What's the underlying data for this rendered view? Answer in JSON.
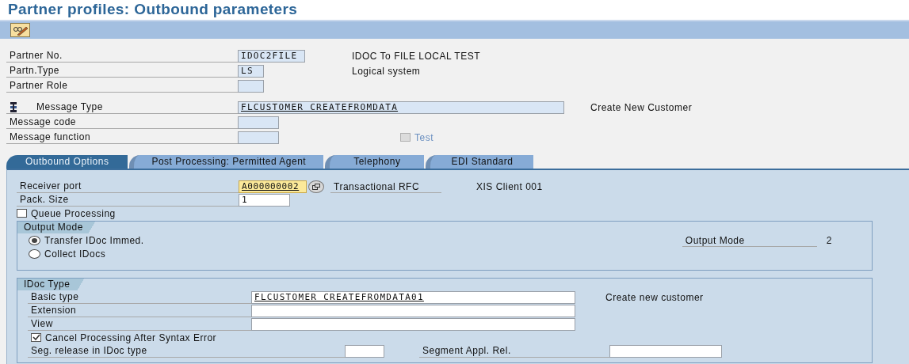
{
  "title": "Partner profiles: Outbound parameters",
  "header": [
    {
      "kind": "field",
      "label": "Partner No.",
      "value": "IDOC2FILE",
      "underlined": false,
      "description": "IDOC To FILE LOCAL TEST"
    },
    {
      "kind": "field",
      "label": "Partn.Type",
      "value": "LS",
      "underlined": false,
      "description": "Logical system"
    },
    {
      "kind": "field",
      "label": "Partner Role"
    },
    {
      "kind": "spacer"
    },
    {
      "kind": "message",
      "label": "Message Type",
      "value": "FLCUSTOMER CREATEFROMDATA",
      "underlined": true,
      "description": "Create New Customer"
    },
    {
      "kind": "field",
      "label": "Message code"
    },
    {
      "kind": "test",
      "label": "Message function",
      "check": {
        "label": "Test",
        "checked": false,
        "disabled": true
      }
    }
  ],
  "tabs": [
    {
      "label": "Outbound Options",
      "selected": true
    },
    {
      "label": "Post Processing: Permitted Agent",
      "selected": false
    },
    {
      "label": "Telephony",
      "selected": false
    },
    {
      "label": "EDI Standard",
      "selected": false
    }
  ],
  "receiver_port": {
    "label": "Receiver port",
    "value": "A000000002",
    "description": "Transactional RFC",
    "extra": "XIS Client 001"
  },
  "pack_size": {
    "label": "Pack. Size",
    "value": "1"
  },
  "queue_processing": {
    "label": "Queue Processing",
    "checked": false
  },
  "output_mode": {
    "title": "Output Mode",
    "options": [
      {
        "label": "Transfer IDoc Immed.",
        "selected": true
      },
      {
        "label": "Collect IDocs",
        "selected": false
      }
    ],
    "mode_label": "Output Mode",
    "mode_value": "2"
  },
  "idoc_type": {
    "title": "IDoc Type",
    "rows": [
      {
        "label": "Basic type",
        "value": "FLCUSTOMER CREATEFROMDATA01",
        "description": "Create new customer"
      },
      {
        "label": "Extension"
      },
      {
        "label": "View"
      }
    ],
    "cancel": {
      "label": "Cancel Processing After Syntax Error",
      "checked": true
    },
    "seg_release": {
      "label": "Seg. release in IDoc type"
    },
    "seg_appl": {
      "label": "Segment Appl. Rel."
    }
  }
}
